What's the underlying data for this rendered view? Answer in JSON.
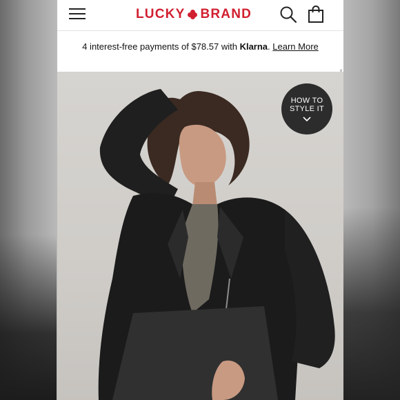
{
  "header": {
    "logo_left": "LUCKY",
    "logo_right": "BRAND",
    "icons": [
      "menu-icon",
      "search-icon",
      "shopping-bag-icon"
    ]
  },
  "payment": {
    "prefix": "4 interest-free payments of $78.57 with ",
    "provider": "Klarna",
    "suffix": ". ",
    "link_label": "Learn More"
  },
  "product": {
    "style_button_line1": "HOW TO",
    "style_button_line2": "STYLE IT",
    "chevron_icon": "chevron-down-icon"
  },
  "colors": {
    "brand_red": "#d11f2f",
    "style_button": "#2c2c2c"
  }
}
